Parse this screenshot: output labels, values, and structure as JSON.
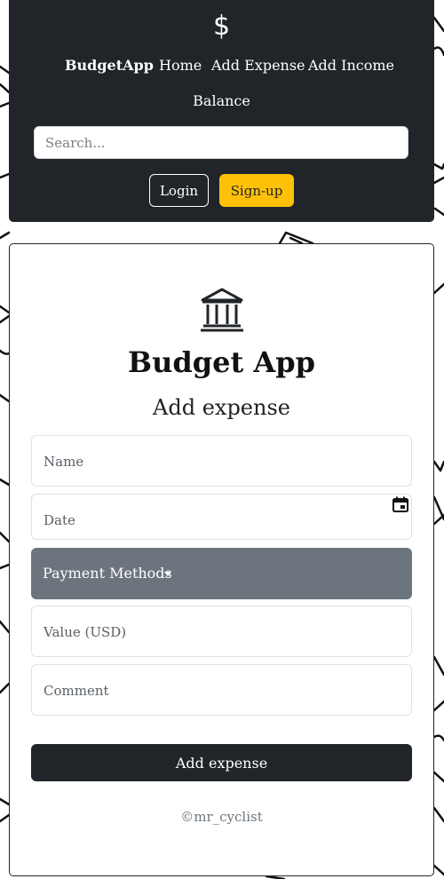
{
  "navbar": {
    "brand_icon_glyph": "$",
    "brand_icon": "dollar-icon",
    "brand_name": "BudgetApp",
    "links": {
      "home": "Home",
      "add_expense": "Add Expense",
      "add_income": "Add Income",
      "balance": "Balance"
    },
    "search_placeholder": "Search...",
    "login_label": "Login",
    "signup_label": "Sign-up",
    "colors": {
      "background": "#212529",
      "signup": "#ffc107"
    }
  },
  "card": {
    "icon": "bank-icon",
    "title": "Budget App",
    "subtitle": "Add expense",
    "fields": {
      "name_placeholder": "Name",
      "date_placeholder": "Date",
      "date_icon": "calendar-icon",
      "payment_label": "Payment Methods",
      "value_placeholder": "Value (USD)",
      "comment_placeholder": "Comment"
    },
    "submit_label": "Add expense",
    "footer": "©mr_cyclist",
    "colors": {
      "payment_background": "#6c757d",
      "submit_background": "#212529"
    }
  }
}
